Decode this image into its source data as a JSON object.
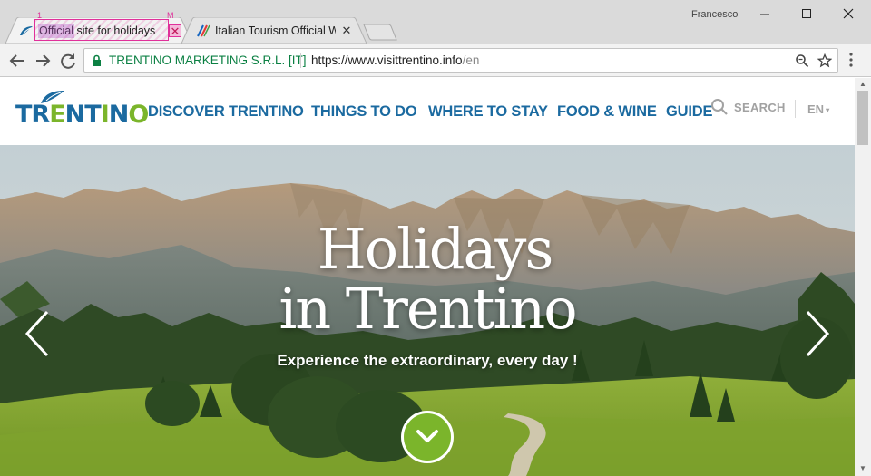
{
  "browser": {
    "user": "Francesco",
    "tabs": [
      {
        "title": "Official site for holidays i",
        "badge_left": "1",
        "badge_right": "M"
      },
      {
        "title": "Italian Tourism Official We"
      }
    ],
    "address": {
      "organization": "TRENTINO MARKETING S.R.L. [IT]",
      "url_host": "https://www.visittrentino.info",
      "url_path": "/en"
    }
  },
  "site": {
    "logo_letters": [
      "T",
      "R",
      "E",
      "N",
      "T",
      "I",
      "N",
      "O"
    ],
    "nav": [
      "DISCOVER TRENTINO",
      "THINGS TO DO",
      "WHERE TO STAY",
      "FOOD & WINE",
      "GUIDE"
    ],
    "search_label": "SEARCH",
    "language": "EN"
  },
  "hero": {
    "title_line1": "Holidays",
    "title_line2": "in Trentino",
    "subtitle": "Experience the extraordinary, every day !"
  },
  "colors": {
    "brand_blue": "#1b6aa0",
    "brand_green": "#7bb52b",
    "secure_green": "#0b8043"
  }
}
